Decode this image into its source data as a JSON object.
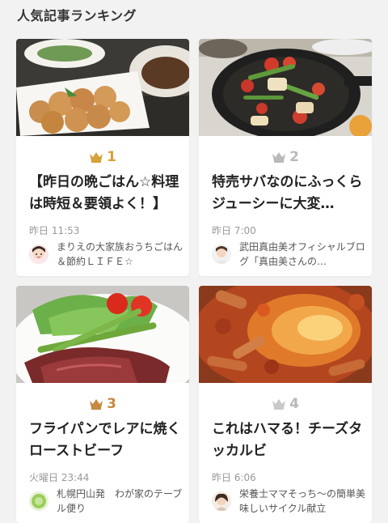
{
  "section_title": "人気記事ランキング",
  "colors": {
    "gold": "#d6a13a",
    "silver": "#b9b9b9",
    "bronze": "#c6893f"
  },
  "articles": [
    {
      "rank": "1",
      "title": "【昨日の晩ごはん☆料理は時短＆要領よく！】",
      "time": "昨日 11:53",
      "author": "まりえの大家族おうちごはん＆節約ＬＩＦＥ☆",
      "crown_icon": "crown-icon",
      "image": "fried-chicken-dinner-photo"
    },
    {
      "rank": "2",
      "title": "特売サバなのにふっくらジューシーに大変…",
      "time": "昨日 7:00",
      "author": "武田真由美オフィシャルブログ「真由美さんの…",
      "crown_icon": "crown-icon",
      "image": "skillet-vegetables-photo"
    },
    {
      "rank": "3",
      "title": "フライパンでレアに焼くローストビーフ",
      "time": "火曜日 23:44",
      "author": "札幌円山発　わが家のテーブル便り",
      "crown_icon": "crown-icon",
      "image": "roast-beef-photo"
    },
    {
      "rank": "4",
      "title": "これはハマる！チーズタッカルビ",
      "time": "昨日 6:06",
      "author": "栄養士ママそっち～の簡単美味しいサイクル献立",
      "crown_icon": "crown-icon",
      "image": "cheese-dakgalbi-photo"
    }
  ]
}
